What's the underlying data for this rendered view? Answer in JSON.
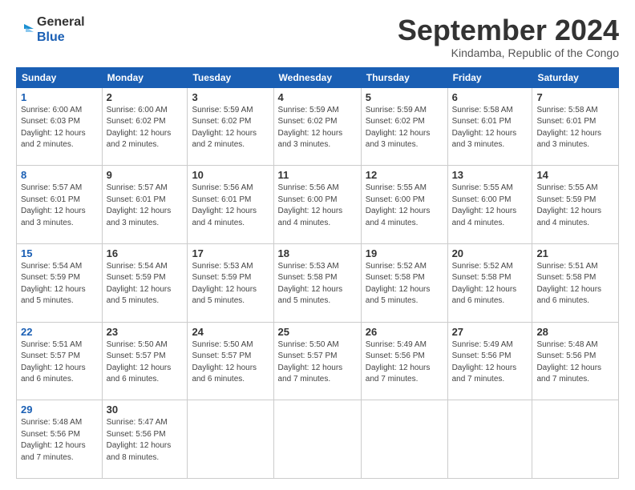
{
  "header": {
    "logo_line1": "General",
    "logo_line2": "Blue",
    "month_title": "September 2024",
    "location": "Kindamba, Republic of the Congo"
  },
  "calendar": {
    "days_of_week": [
      "Sunday",
      "Monday",
      "Tuesday",
      "Wednesday",
      "Thursday",
      "Friday",
      "Saturday"
    ],
    "weeks": [
      [
        {
          "day": "1",
          "info": "Sunrise: 6:00 AM\nSunset: 6:03 PM\nDaylight: 12 hours\nand 2 minutes."
        },
        {
          "day": "2",
          "info": "Sunrise: 6:00 AM\nSunset: 6:02 PM\nDaylight: 12 hours\nand 2 minutes."
        },
        {
          "day": "3",
          "info": "Sunrise: 5:59 AM\nSunset: 6:02 PM\nDaylight: 12 hours\nand 2 minutes."
        },
        {
          "day": "4",
          "info": "Sunrise: 5:59 AM\nSunset: 6:02 PM\nDaylight: 12 hours\nand 3 minutes."
        },
        {
          "day": "5",
          "info": "Sunrise: 5:59 AM\nSunset: 6:02 PM\nDaylight: 12 hours\nand 3 minutes."
        },
        {
          "day": "6",
          "info": "Sunrise: 5:58 AM\nSunset: 6:01 PM\nDaylight: 12 hours\nand 3 minutes."
        },
        {
          "day": "7",
          "info": "Sunrise: 5:58 AM\nSunset: 6:01 PM\nDaylight: 12 hours\nand 3 minutes."
        }
      ],
      [
        {
          "day": "8",
          "info": "Sunrise: 5:57 AM\nSunset: 6:01 PM\nDaylight: 12 hours\nand 3 minutes."
        },
        {
          "day": "9",
          "info": "Sunrise: 5:57 AM\nSunset: 6:01 PM\nDaylight: 12 hours\nand 3 minutes."
        },
        {
          "day": "10",
          "info": "Sunrise: 5:56 AM\nSunset: 6:01 PM\nDaylight: 12 hours\nand 4 minutes."
        },
        {
          "day": "11",
          "info": "Sunrise: 5:56 AM\nSunset: 6:00 PM\nDaylight: 12 hours\nand 4 minutes."
        },
        {
          "day": "12",
          "info": "Sunrise: 5:55 AM\nSunset: 6:00 PM\nDaylight: 12 hours\nand 4 minutes."
        },
        {
          "day": "13",
          "info": "Sunrise: 5:55 AM\nSunset: 6:00 PM\nDaylight: 12 hours\nand 4 minutes."
        },
        {
          "day": "14",
          "info": "Sunrise: 5:55 AM\nSunset: 5:59 PM\nDaylight: 12 hours\nand 4 minutes."
        }
      ],
      [
        {
          "day": "15",
          "info": "Sunrise: 5:54 AM\nSunset: 5:59 PM\nDaylight: 12 hours\nand 5 minutes."
        },
        {
          "day": "16",
          "info": "Sunrise: 5:54 AM\nSunset: 5:59 PM\nDaylight: 12 hours\nand 5 minutes."
        },
        {
          "day": "17",
          "info": "Sunrise: 5:53 AM\nSunset: 5:59 PM\nDaylight: 12 hours\nand 5 minutes."
        },
        {
          "day": "18",
          "info": "Sunrise: 5:53 AM\nSunset: 5:58 PM\nDaylight: 12 hours\nand 5 minutes."
        },
        {
          "day": "19",
          "info": "Sunrise: 5:52 AM\nSunset: 5:58 PM\nDaylight: 12 hours\nand 5 minutes."
        },
        {
          "day": "20",
          "info": "Sunrise: 5:52 AM\nSunset: 5:58 PM\nDaylight: 12 hours\nand 6 minutes."
        },
        {
          "day": "21",
          "info": "Sunrise: 5:51 AM\nSunset: 5:58 PM\nDaylight: 12 hours\nand 6 minutes."
        }
      ],
      [
        {
          "day": "22",
          "info": "Sunrise: 5:51 AM\nSunset: 5:57 PM\nDaylight: 12 hours\nand 6 minutes."
        },
        {
          "day": "23",
          "info": "Sunrise: 5:50 AM\nSunset: 5:57 PM\nDaylight: 12 hours\nand 6 minutes."
        },
        {
          "day": "24",
          "info": "Sunrise: 5:50 AM\nSunset: 5:57 PM\nDaylight: 12 hours\nand 6 minutes."
        },
        {
          "day": "25",
          "info": "Sunrise: 5:50 AM\nSunset: 5:57 PM\nDaylight: 12 hours\nand 7 minutes."
        },
        {
          "day": "26",
          "info": "Sunrise: 5:49 AM\nSunset: 5:56 PM\nDaylight: 12 hours\nand 7 minutes."
        },
        {
          "day": "27",
          "info": "Sunrise: 5:49 AM\nSunset: 5:56 PM\nDaylight: 12 hours\nand 7 minutes."
        },
        {
          "day": "28",
          "info": "Sunrise: 5:48 AM\nSunset: 5:56 PM\nDaylight: 12 hours\nand 7 minutes."
        }
      ],
      [
        {
          "day": "29",
          "info": "Sunrise: 5:48 AM\nSunset: 5:56 PM\nDaylight: 12 hours\nand 7 minutes."
        },
        {
          "day": "30",
          "info": "Sunrise: 5:47 AM\nSunset: 5:56 PM\nDaylight: 12 hours\nand 8 minutes."
        },
        {
          "day": "",
          "info": ""
        },
        {
          "day": "",
          "info": ""
        },
        {
          "day": "",
          "info": ""
        },
        {
          "day": "",
          "info": ""
        },
        {
          "day": "",
          "info": ""
        }
      ]
    ]
  }
}
